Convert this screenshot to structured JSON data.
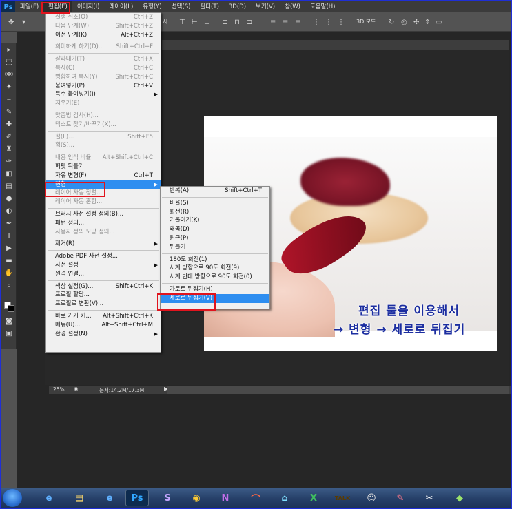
{
  "app": {
    "logo": "Ps"
  },
  "menubar": {
    "items": [
      "파일(F)",
      "편집(E)",
      "이미지(I)",
      "레이어(L)",
      "유형(Y)",
      "선택(S)",
      "필터(T)",
      "3D(D)",
      "보기(V)",
      "창(W)",
      "도움말(H)"
    ]
  },
  "optbar": {
    "show_label": "시",
    "mode3d_label": "3D 모드:"
  },
  "edit_menu": {
    "items": [
      {
        "label": "실행 취소(O)",
        "shortcut": "Ctrl+Z",
        "disabled": true
      },
      {
        "label": "다음 단계(W)",
        "shortcut": "Shift+Ctrl+Z",
        "disabled": true
      },
      {
        "label": "이전 단계(K)",
        "shortcut": "Alt+Ctrl+Z",
        "disabled": false
      },
      {
        "sep": true
      },
      {
        "label": "희미하게 하기(D)...",
        "shortcut": "Shift+Ctrl+F",
        "disabled": true
      },
      {
        "sep": true
      },
      {
        "label": "잘라내기(T)",
        "shortcut": "Ctrl+X",
        "disabled": true
      },
      {
        "label": "복사(C)",
        "shortcut": "Ctrl+C",
        "disabled": true
      },
      {
        "label": "병합하여 복사(Y)",
        "shortcut": "Shift+Ctrl+C",
        "disabled": true
      },
      {
        "label": "붙여넣기(P)",
        "shortcut": "Ctrl+V",
        "disabled": false
      },
      {
        "label": "특수 붙여넣기(I)",
        "shortcut": "",
        "disabled": false,
        "submenu": true
      },
      {
        "label": "지우기(E)",
        "shortcut": "",
        "disabled": true
      },
      {
        "sep": true
      },
      {
        "label": "맞춤법 검사(H)...",
        "shortcut": "",
        "disabled": true
      },
      {
        "label": "텍스트 찾기/바꾸기(X)...",
        "shortcut": "",
        "disabled": true
      },
      {
        "sep": true
      },
      {
        "label": "칠(L)...",
        "shortcut": "Shift+F5",
        "disabled": true
      },
      {
        "label": "획(S)...",
        "shortcut": "",
        "disabled": true
      },
      {
        "sep": true
      },
      {
        "label": "내용 인식 비율",
        "shortcut": "Alt+Shift+Ctrl+C",
        "disabled": true
      },
      {
        "label": "퍼펫 뒤틀기",
        "shortcut": "",
        "disabled": false
      },
      {
        "label": "자유 변형(F)",
        "shortcut": "Ctrl+T",
        "disabled": false
      },
      {
        "label": "변형",
        "shortcut": "",
        "disabled": false,
        "submenu": true,
        "highlighted": true
      },
      {
        "label": "레이어 자동 정렬...",
        "shortcut": "",
        "disabled": true
      },
      {
        "label": "레이어 자동 혼합...",
        "shortcut": "",
        "disabled": true
      },
      {
        "sep": true
      },
      {
        "label": "브러시 사전 설정 정의(B)...",
        "shortcut": "",
        "disabled": false
      },
      {
        "label": "패턴 정의...",
        "shortcut": "",
        "disabled": false
      },
      {
        "label": "사용자 정의 모양 정의...",
        "shortcut": "",
        "disabled": true
      },
      {
        "sep": true
      },
      {
        "label": "제거(R)",
        "shortcut": "",
        "disabled": false,
        "submenu": true
      },
      {
        "sep": true
      },
      {
        "label": "Adobe PDF 사전 설정...",
        "shortcut": "",
        "disabled": false
      },
      {
        "label": "사전 설정",
        "shortcut": "",
        "disabled": false,
        "submenu": true
      },
      {
        "label": "원격 연결...",
        "shortcut": "",
        "disabled": false
      },
      {
        "sep": true
      },
      {
        "label": "색상 설정(G)...",
        "shortcut": "Shift+Ctrl+K",
        "disabled": false
      },
      {
        "label": "프로필 할당...",
        "shortcut": "",
        "disabled": false
      },
      {
        "label": "프로필로 변환(V)...",
        "shortcut": "",
        "disabled": false
      },
      {
        "sep": true
      },
      {
        "label": "바로 가기 키...",
        "shortcut": "Alt+Shift+Ctrl+K",
        "disabled": false
      },
      {
        "label": "메뉴(U)...",
        "shortcut": "Alt+Shift+Ctrl+M",
        "disabled": false
      },
      {
        "label": "환경 설정(N)",
        "shortcut": "",
        "disabled": false,
        "submenu": true
      }
    ]
  },
  "transform_menu": {
    "items": [
      {
        "label": "반복(A)",
        "shortcut": "Shift+Ctrl+T",
        "disabled": false
      },
      {
        "sep": true
      },
      {
        "label": "비율(S)",
        "shortcut": "",
        "disabled": false
      },
      {
        "label": "회전(R)",
        "shortcut": "",
        "disabled": false
      },
      {
        "label": "기울이기(K)",
        "shortcut": "",
        "disabled": false
      },
      {
        "label": "왜곡(D)",
        "shortcut": "",
        "disabled": false
      },
      {
        "label": "원근(P)",
        "shortcut": "",
        "disabled": false
      },
      {
        "label": "뒤틀기",
        "shortcut": "",
        "disabled": false
      },
      {
        "sep": true
      },
      {
        "label": "180도 회전(1)",
        "shortcut": "",
        "disabled": false
      },
      {
        "label": "시계 방향으로 90도 회전(9)",
        "shortcut": "",
        "disabled": false
      },
      {
        "label": "시계 반대 방향으로 90도 회전(0)",
        "shortcut": "",
        "disabled": false
      },
      {
        "sep": true
      },
      {
        "label": "가로로 뒤집기(H)",
        "shortcut": "",
        "disabled": false
      },
      {
        "label": "세로로 뒤집기(V)",
        "shortcut": "",
        "disabled": false,
        "highlighted": true
      }
    ]
  },
  "image_caption": {
    "line1": "편집 툴을 이용해서",
    "line2": "→ 변형 → 세로로 뒤집기"
  },
  "statusbar": {
    "zoom": "25%",
    "doc_info": "문서:14.2M/17.3M"
  },
  "colors": {
    "highlight": "#2e8ef0",
    "annotation_red": "#e0141e",
    "caption_blue": "#1c2ea0"
  }
}
